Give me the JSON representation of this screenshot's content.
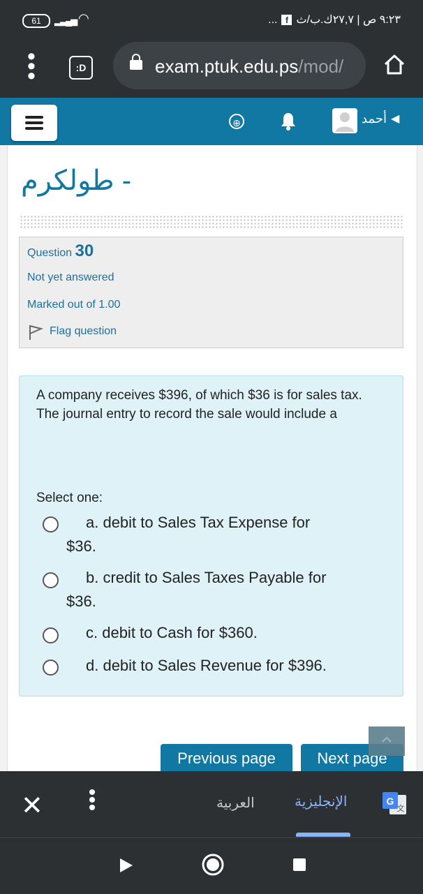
{
  "status_bar": {
    "battery": "61",
    "right_text": "٩:٢٣ ص | ٢٧,٧ك.ب/ث",
    "more": "..."
  },
  "browser": {
    "url_host": "exam.ptuk.edu.ps",
    "url_path": "/mod/",
    "tab_switcher_label": ":D"
  },
  "site_header": {
    "user_name": "أحمد"
  },
  "course": {
    "title_line_2": "- طولكرم"
  },
  "question_info": {
    "label": "Question",
    "number": "30",
    "state": "Not yet answered",
    "marked_out_of": "Marked out of 1.00",
    "flag_label": "Flag question"
  },
  "question": {
    "text": "A company receives $396, of which $36 is for sales tax. The journal entry to record the sale would include a",
    "prompt": "Select one:",
    "options": [
      {
        "line1": "a. debit to Sales Tax Expense for",
        "line2": "$36."
      },
      {
        "line1": "b. credit to Sales Taxes Payable for",
        "line2": "$36."
      },
      {
        "line1": "c. debit to Cash for $360.",
        "line2": ""
      },
      {
        "line1": "d. debit to Sales Revenue for $396.",
        "line2": ""
      }
    ]
  },
  "navigation": {
    "previous": "Previous page",
    "next": "Next page"
  },
  "translate_bar": {
    "source_lang": "العربية",
    "target_lang": "الإنجليزية"
  }
}
